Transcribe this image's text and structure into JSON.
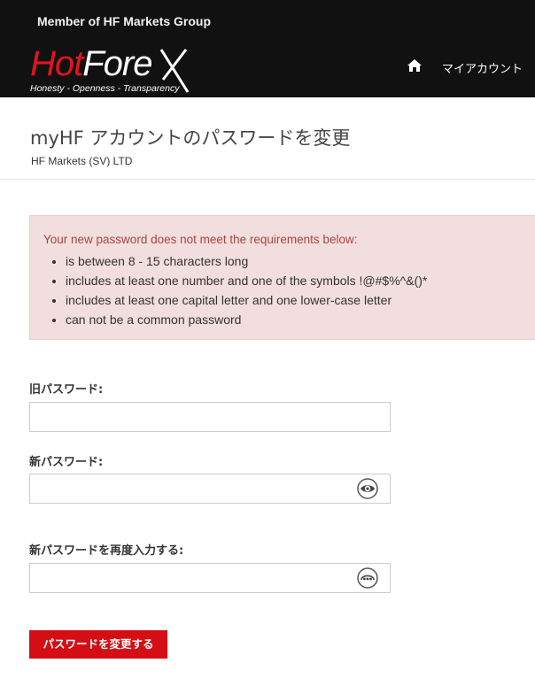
{
  "header": {
    "member_text": "Member of HF Markets Group",
    "logo": {
      "hot": "Hot",
      "forex": "Fore",
      "tagline": "Honesty - Openness - Transparency"
    },
    "nav_account": "マイアカウント",
    "home_icon": "home-icon"
  },
  "page": {
    "title": "myHF アカウントのパスワードを変更",
    "subtitle": "HF Markets (SV) LTD"
  },
  "alert": {
    "message": "Your new password does not meet the requirements below:",
    "requirements": [
      "is between 8 - 15 characters long",
      "includes at least one number and one of the symbols !@#$%^&()*",
      "includes at least one capital letter and one lower-case letter",
      "can not be a common password"
    ]
  },
  "form": {
    "old_password_label": "旧パスワード:",
    "old_password_value": "",
    "new_password_label": "新パスワード:",
    "new_password_value": "",
    "confirm_password_label": "新パスワードを再度入力する:",
    "confirm_password_value": "",
    "submit_label": "パスワードを変更する"
  },
  "colors": {
    "topbar": "#111111",
    "brand_red": "#d40e14",
    "alert_bg": "#f2dede",
    "alert_text": "#a94442"
  }
}
